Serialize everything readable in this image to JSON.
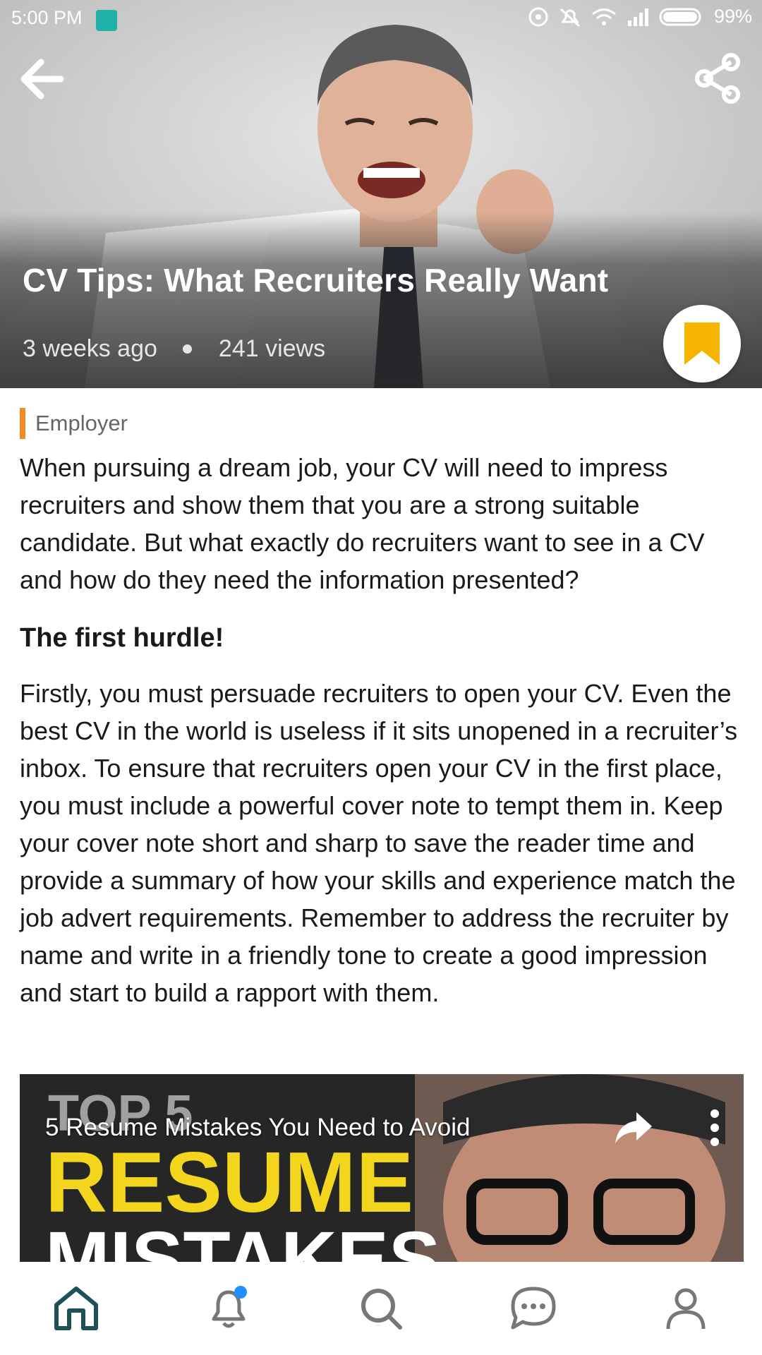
{
  "status_bar": {
    "time": "5:00 PM",
    "battery": "99%"
  },
  "header": {
    "back_icon": "back-arrow-icon",
    "share_icon": "share-icon"
  },
  "article": {
    "title": "CV Tips: What Recruiters Really Want",
    "posted": "3 weeks ago",
    "views": "241 views",
    "bookmark_icon": "bookmark-icon",
    "category": "Employer",
    "intro": "When pursuing a dream job, your CV will need to impress recruiters and show them that you are a strong suitable candidate. But what exactly do recruiters want to see in a CV and how do they need the information presented?",
    "subheading": "The first hurdle!",
    "body": "Firstly, you must persuade recruiters to open your CV. Even the best CV in the world is useless if it sits unopened in a recruiter’s inbox. To ensure that recruiters open your CV in the first place, you must include a powerful cover note to tempt them in. Keep your cover note short and sharp to save the reader time and provide a summary of how your skills and experience match the job advert requirements. Remember to address the recruiter by name and write in a friendly tone to create a good impression and start to build a rapport with them."
  },
  "video": {
    "title": "5 Resume Mistakes You Need to Avoid",
    "thumb_line1": "TOP 5",
    "thumb_line2": "RESUME",
    "thumb_line3": "MISTAKES"
  },
  "bottom_nav": {
    "items": [
      {
        "icon": "home-icon",
        "active": true
      },
      {
        "icon": "bell-icon",
        "badge": true
      },
      {
        "icon": "search-icon"
      },
      {
        "icon": "chat-icon"
      },
      {
        "icon": "profile-icon"
      }
    ]
  },
  "colors": {
    "accent_orange": "#f08a24",
    "bookmark_yellow": "#f5b400",
    "nav_active": "#1f4f57",
    "nav_inactive": "#777777",
    "badge_blue": "#1e90ff"
  }
}
